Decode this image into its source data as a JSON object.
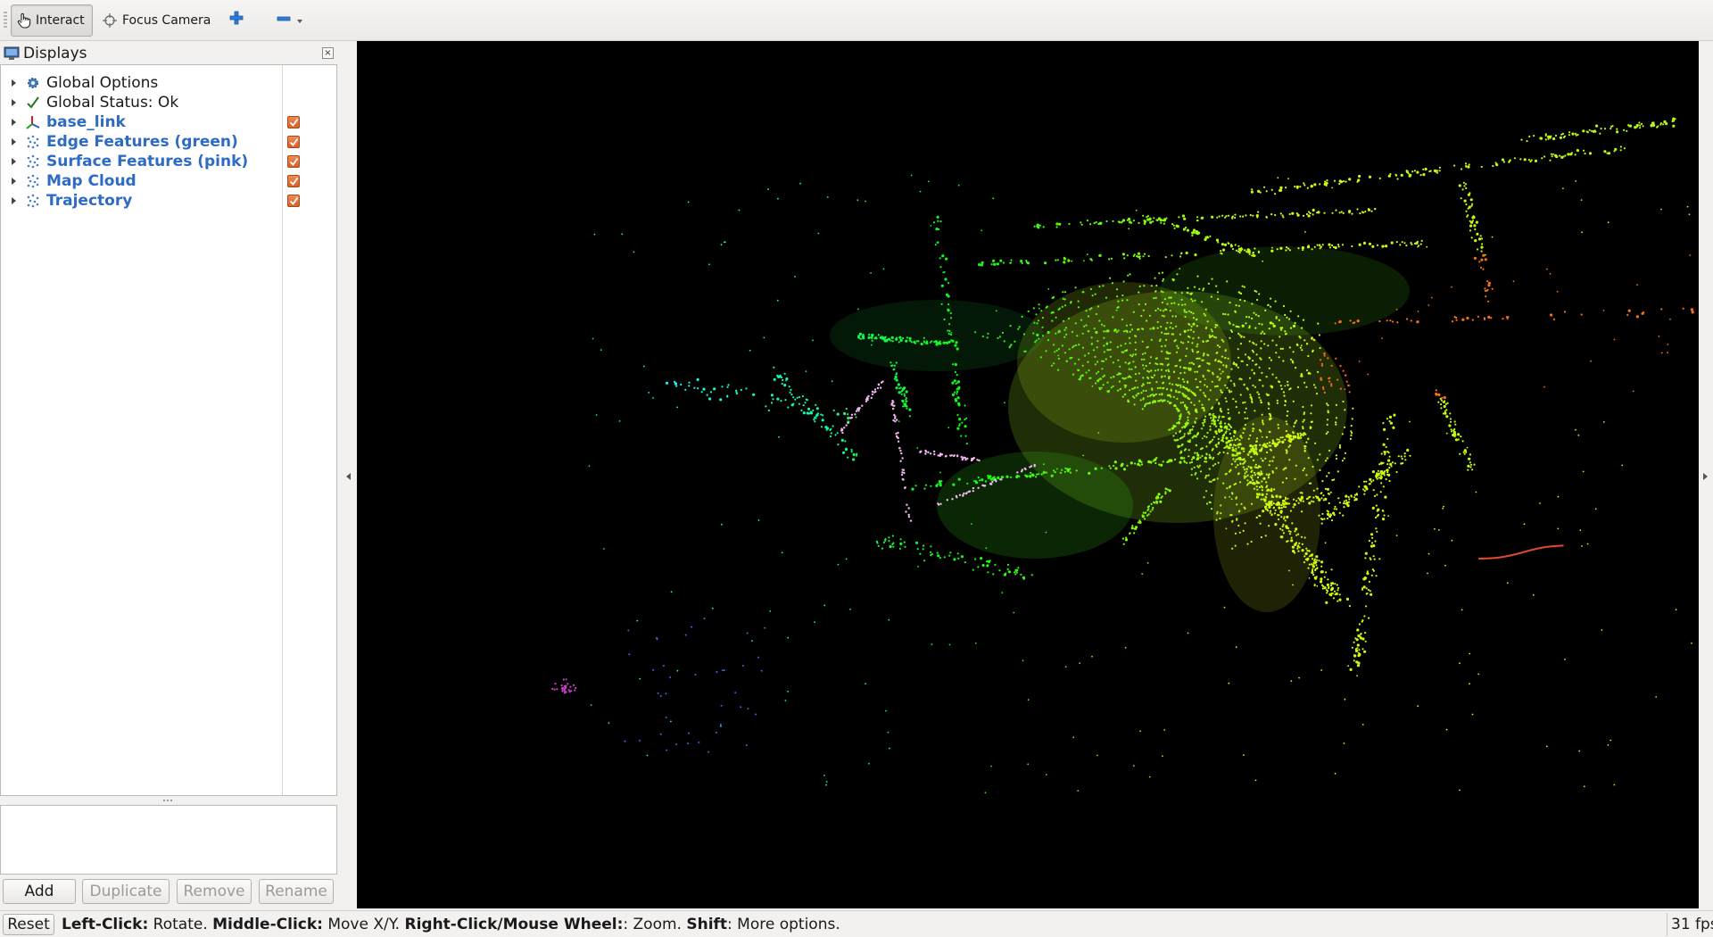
{
  "toolbar": {
    "interact_label": "Interact",
    "focus_camera_label": "Focus Camera"
  },
  "displays_panel": {
    "title": "Displays",
    "close_glyph": "×",
    "items": [
      {
        "label": "Global Options",
        "icon": "gear-icon",
        "checked": null
      },
      {
        "label": "Global Status: Ok",
        "icon": "checkmark-icon",
        "checked": null
      },
      {
        "label": "base_link",
        "icon": "axes-icon",
        "checked": true
      },
      {
        "label": "Edge Features (green)",
        "icon": "point-cloud-icon",
        "checked": true
      },
      {
        "label": "Surface Features (pink)",
        "icon": "point-cloud-icon",
        "checked": true
      },
      {
        "label": "Map Cloud",
        "icon": "point-cloud-icon",
        "checked": true
      },
      {
        "label": "Trajectory",
        "icon": "point-cloud-icon",
        "checked": true
      }
    ],
    "buttons": {
      "add": "Add",
      "duplicate": "Duplicate",
      "remove": "Remove",
      "rename": "Rename"
    }
  },
  "statusbar": {
    "reset_label": "Reset",
    "hint_parts": [
      {
        "bold": true,
        "text": "Left-Click:"
      },
      {
        "bold": false,
        "text": " Rotate. "
      },
      {
        "bold": true,
        "text": "Middle-Click:"
      },
      {
        "bold": false,
        "text": " Move X/Y. "
      },
      {
        "bold": true,
        "text": "Right-Click/Mouse Wheel:"
      },
      {
        "bold": false,
        "text": ": Zoom. "
      },
      {
        "bold": true,
        "text": "Shift"
      },
      {
        "bold": false,
        "text": ": More options."
      }
    ],
    "fps": "31 fps"
  },
  "colors": {
    "viewport_background": "#000000",
    "link_text": "#2d6bc4",
    "checkbox": "#e0703a"
  }
}
